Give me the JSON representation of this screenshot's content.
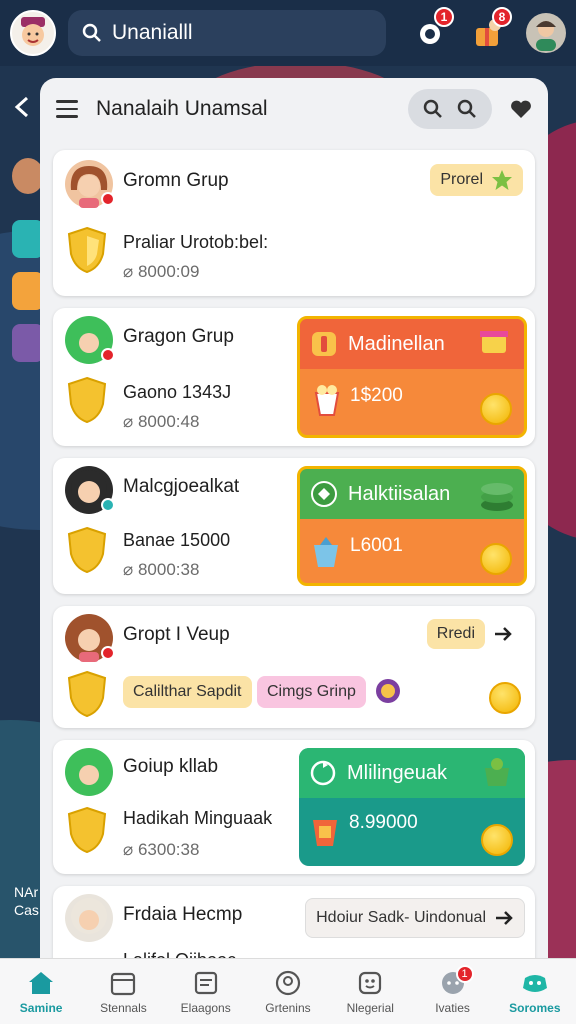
{
  "search": {
    "value": "Unanialll"
  },
  "top_badges": {
    "notifications": "1",
    "gifts": "8"
  },
  "panel": {
    "title": "Nanalaih Unamsal"
  },
  "side_labels": {
    "a": "NAr",
    "b": "Cas"
  },
  "cards": [
    {
      "name": "Gromn Grup",
      "line2": "Praliar Urotob:bel:",
      "time": "8000:09",
      "chip": "Prorel",
      "chip_color": "#fbe3a6"
    },
    {
      "name": "Gragon Grup",
      "line2": "Gaono 1343J",
      "time": "8000:48",
      "promo_title": "Madinellan",
      "promo_value": "1$200",
      "promo_color": "#f6893a"
    },
    {
      "name": "Malcgjoealkat",
      "line2": "Banae 15000",
      "time": "8000:38",
      "promo_title": "Halktiisalan",
      "promo_value": "L6001",
      "promo_color": "#4caf50"
    },
    {
      "name": "Gropt I Veup",
      "chip": "Rredi",
      "chip_color": "#fbe3a6",
      "tag1": "Calilthar Sapdit",
      "tag2": "Cimgs Grinp"
    },
    {
      "name": "Goiup kllab",
      "line2": "Hadikah Minguaak",
      "time": "6300:38",
      "promo_title": "Mlilingeuak",
      "promo_value": "8.99000",
      "promo_color": "#1a9a8a"
    },
    {
      "name": "Frdaia Hecmp",
      "line2": "Lalifol Oiibooc",
      "chip": "Hdoiur Sadk- Uindonual"
    }
  ],
  "bottom_nav": [
    {
      "label": "Samine",
      "active": true
    },
    {
      "label": "Stennals"
    },
    {
      "label": "Elaagons"
    },
    {
      "label": "Grtenins"
    },
    {
      "label": "Nlegerial"
    },
    {
      "label": "Ivaties",
      "badge": "1"
    },
    {
      "label": "Soromes"
    }
  ]
}
